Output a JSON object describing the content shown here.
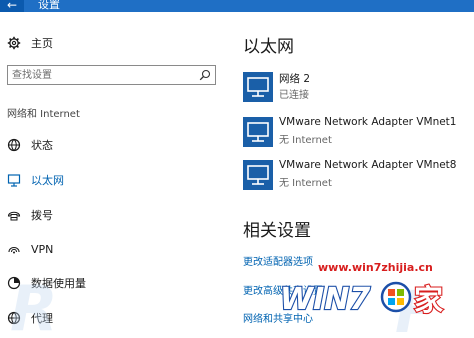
{
  "window": {
    "title": "设置",
    "back_icon": "back-arrow-icon",
    "accent": "#1f6fc5"
  },
  "sidebar": {
    "home_label": "主页",
    "search_placeholder": "查找设置",
    "section_label": "网络和 Internet",
    "items": [
      {
        "label": "状态",
        "icon": "status-globe-icon",
        "active": false
      },
      {
        "label": "以太网",
        "icon": "ethernet-icon",
        "active": true
      },
      {
        "label": "拨号",
        "icon": "dialup-icon",
        "active": false
      },
      {
        "label": "VPN",
        "icon": "vpn-icon",
        "active": false
      },
      {
        "label": "数据使用量",
        "icon": "data-usage-icon",
        "active": false
      },
      {
        "label": "代理",
        "icon": "proxy-globe-icon",
        "active": false
      }
    ],
    "active_color": "#0063b1"
  },
  "main": {
    "title": "以太网",
    "networks": [
      {
        "name": "网络  2",
        "status": "已连接"
      },
      {
        "name": "VMware Network Adapter VMnet1",
        "status": "无 Internet"
      },
      {
        "name": "VMware Network Adapter VMnet8",
        "status": "无 Internet"
      }
    ],
    "related_title": "相关设置",
    "links": [
      "更改适配器选项",
      "更改高级共享设置",
      "网络和共享中心"
    ],
    "link_color": "#0063b1"
  },
  "watermark": {
    "url": "www.win7zhijia.cn",
    "logo_text_win": "WIN7",
    "logo_text_home": "家",
    "color_url": "#d81e1e"
  }
}
